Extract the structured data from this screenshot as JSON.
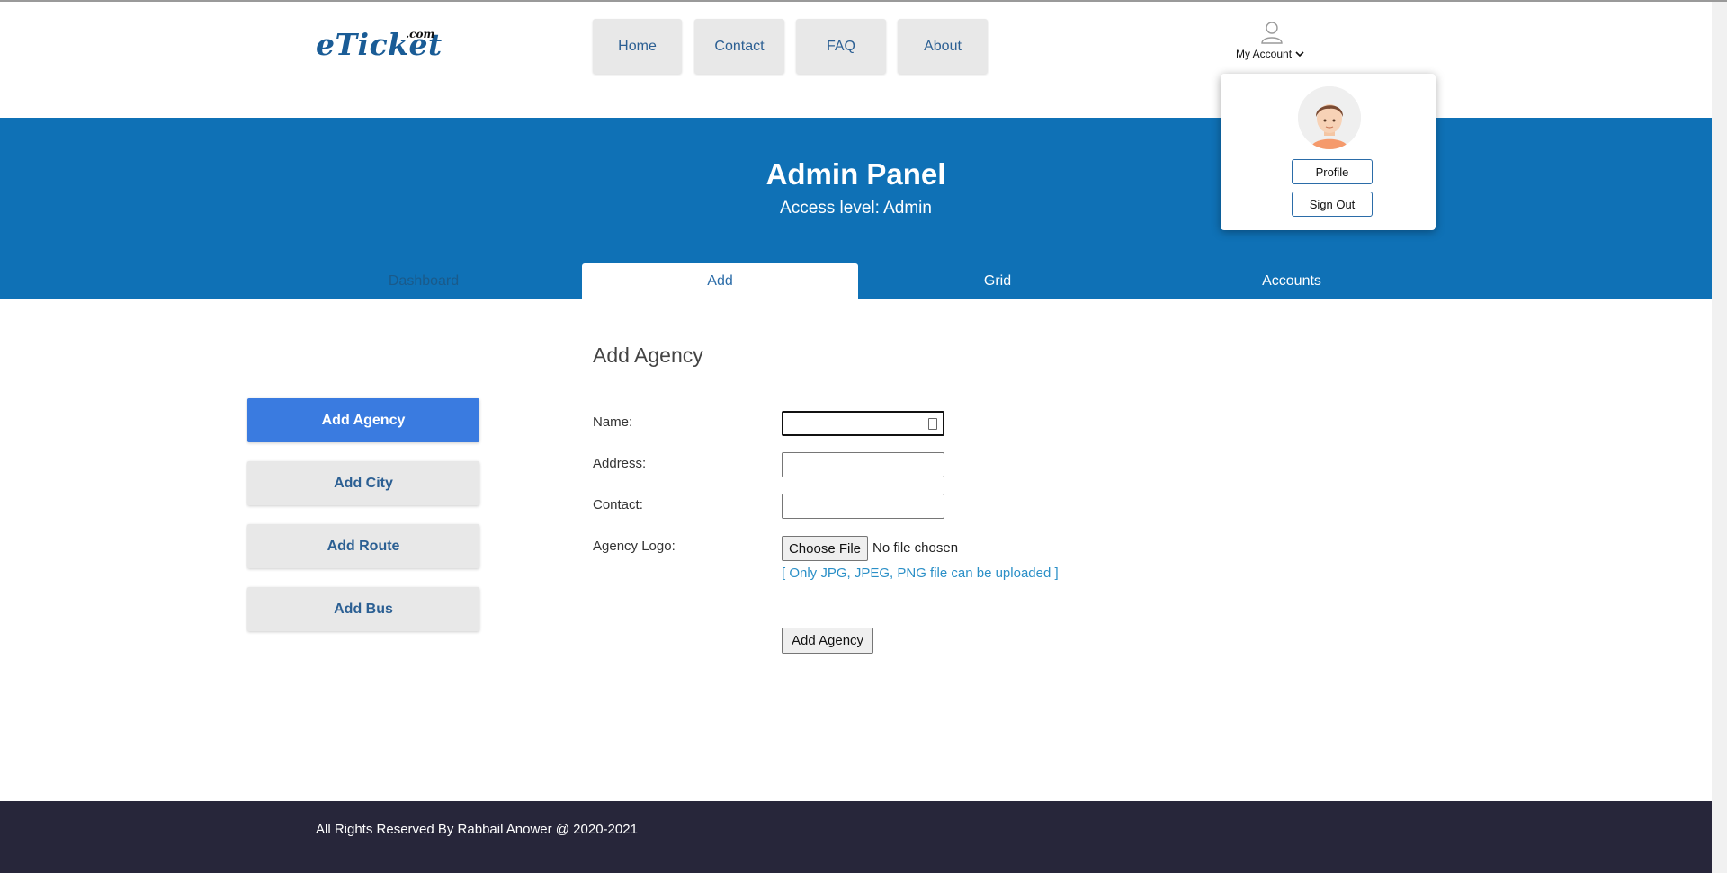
{
  "header": {
    "logo": "eTicket",
    "logo_suffix": ".com",
    "nav": [
      "Home",
      "Contact",
      "FAQ",
      "About"
    ],
    "account_label": "My Account"
  },
  "banner": {
    "title": "Admin Panel",
    "subtitle": "Access level: Admin",
    "tabs": [
      "Dashboard",
      "Add",
      "Grid",
      "Accounts"
    ],
    "active_tab": "Add"
  },
  "account_popup": {
    "profile_label": "Profile",
    "signout_label": "Sign Out"
  },
  "sidebar": {
    "items": [
      "Add Agency",
      "Add City",
      "Add Route",
      "Add Bus"
    ],
    "active_item": "Add Agency"
  },
  "form": {
    "title": "Add Agency",
    "fields": [
      {
        "label": "Name:",
        "value": ""
      },
      {
        "label": "Address:",
        "value": ""
      },
      {
        "label": "Contact:",
        "value": ""
      }
    ],
    "logo_label": "Agency Logo:",
    "choose_file_label": "Choose File",
    "file_status": "No file chosen",
    "file_hint": "[ Only JPG, JPEG, PNG file can be uploaded ]",
    "submit_label": "Add Agency"
  },
  "footer": {
    "text": "All Rights Reserved By Rabbail Anower @ 2020-2021"
  },
  "colors": {
    "banner": "#0f71b6",
    "active_side": "#3a7be0",
    "footer": "#27263a",
    "link": "#2b5f93"
  }
}
